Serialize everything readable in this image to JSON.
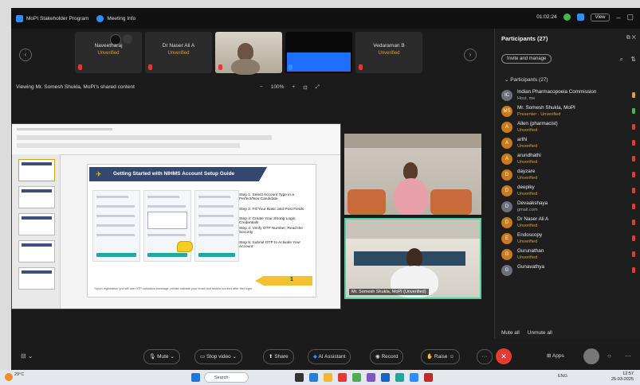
{
  "titlebar": {
    "app_tab": "MoPI Stakeholder Program",
    "info_tab": "Meeting Info",
    "timer": "01:02:24",
    "view_button": "View"
  },
  "strip": {
    "tiles": [
      {
        "name": "Naveetharaj",
        "status": "Unverified"
      },
      {
        "name": "Dr Naser Ali A",
        "status": "Unverified"
      },
      {
        "name": "",
        "status": ""
      },
      {
        "name": "",
        "status": ""
      },
      {
        "name": "Vedaraman B",
        "status": "Unverified"
      }
    ]
  },
  "viewing_label": "Viewing Mr. Somesh Shukla, MoPI's shared content",
  "zoom": {
    "value": "100%",
    "plus": "+",
    "minus": "−"
  },
  "slide": {
    "title": "Getting Started with NIHMS Account Setup Guide",
    "steps": [
      "Step 1: Select Account Type in a Perfect/Non Candidate",
      "Step 2: Fill Your Basic and Post Fields",
      "Step 3: Create Your Strong Login Credentials",
      "Step 4: Verify OTP Number, Read the Security",
      "Step 5: Submit OTP to Activate Your Account"
    ],
    "badge": "1",
    "footnote": "*Upon registration you will see OTP validation message, please validate your email and mobile number after first login."
  },
  "videos": {
    "presenter_label": "Mr. Somesh Shukla, MoPI (Unverified)"
  },
  "participants": {
    "title": "Participants (27)",
    "mute_button": "Invite and manage",
    "section": "Participants (27)",
    "list": [
      {
        "initial": "IC",
        "name": "Indian Pharmacopoeia Commission",
        "sub": "Host, me",
        "avatar": "grey",
        "mic": "amber"
      },
      {
        "initial": "MS",
        "name": "Mr. Somesh Shukla, MoPI",
        "sub": "Presenter · Unverified",
        "avatar": "orange",
        "mic": "green"
      },
      {
        "initial": "A",
        "name": "Allen (pharmacist)",
        "sub": "Unverified",
        "avatar": "orange",
        "mic": "red"
      },
      {
        "initial": "A",
        "name": "arthi",
        "sub": "Unverified",
        "avatar": "orange",
        "mic": "red"
      },
      {
        "initial": "A",
        "name": "arundhathi",
        "sub": "Unverified",
        "avatar": "orange",
        "mic": "red"
      },
      {
        "initial": "D",
        "name": "dayzare",
        "sub": "Unverified",
        "avatar": "orange",
        "mic": "red"
      },
      {
        "initial": "D",
        "name": "deepiky",
        "sub": "Unverified",
        "avatar": "orange",
        "mic": "red"
      },
      {
        "initial": "D",
        "name": "Devaakshaya",
        "sub": "gmail.com",
        "avatar": "grey",
        "mic": "red"
      },
      {
        "initial": "D",
        "name": "Dr Naser Ali A",
        "sub": "Unverified",
        "avatar": "orange",
        "mic": "red"
      },
      {
        "initial": "E",
        "name": "Endoscopy",
        "sub": "Unverified",
        "avatar": "orange",
        "mic": "red"
      },
      {
        "initial": "G",
        "name": "Gurunathan",
        "sub": "Unverified",
        "avatar": "orange",
        "mic": "red"
      },
      {
        "initial": "G",
        "name": "Gunavathya",
        "sub": "",
        "avatar": "grey",
        "mic": "red"
      }
    ],
    "mute_all": "Mute all",
    "unmute_all": "Unmute all"
  },
  "toolbar": {
    "mute": "Mute",
    "stop_video": "Stop video",
    "share": "Share",
    "ai_assistant": "AI Assistant",
    "record": "Record",
    "raise": "Raise",
    "apps": "Apps",
    "more": "···",
    "end": "✕"
  },
  "taskbar": {
    "weather": "29°C",
    "search": "Search",
    "time": "12:57",
    "date": "25-03-2025",
    "lang": "ENG"
  },
  "colors": {
    "accent": "#2d8cff",
    "danger": "#e53935",
    "warning": "#e0a030",
    "speaking": "#4fd1a0",
    "banner": "#34476e"
  }
}
